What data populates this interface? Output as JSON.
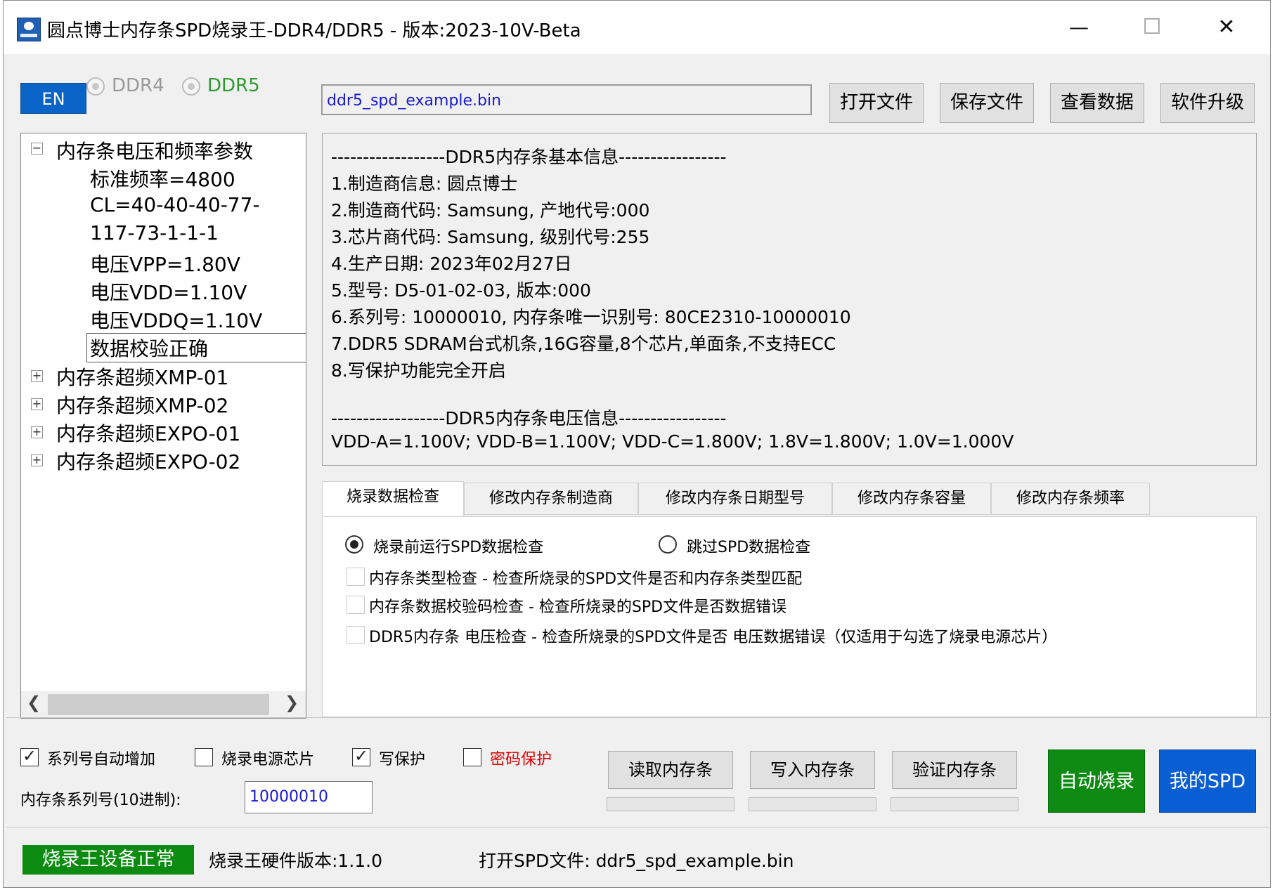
{
  "window": {
    "title": "圆点博士内存条SPD烧录王-DDR4/DDR5 - 版本:2023-10V-Beta",
    "minimize_glyph": "—",
    "maximize_glyph": "☐",
    "close_glyph": "✕"
  },
  "toolbar": {
    "lang_button": "EN",
    "ddr4_label": "DDR4",
    "ddr5_label": "DDR5",
    "file_name": "ddr5_spd_example.bin",
    "open_file": "打开文件",
    "save_file": "保存文件",
    "view_data": "查看数据",
    "upgrade": "软件升级"
  },
  "tree": {
    "root_label": "内存条电压和频率参数",
    "children": [
      "标准频率=4800",
      "CL=40-40-40-77-",
      "117-73-1-1-1",
      "电压VPP=1.80V",
      "电压VDD=1.10V",
      "电压VDDQ=1.10V",
      "数据校验正确"
    ],
    "collapsed_nodes": [
      "内存条超频XMP-01",
      "内存条超频XMP-02",
      "内存条超频EXPO-01",
      "内存条超频EXPO-02"
    ]
  },
  "info_lines": [
    "------------------DDR5内存条基本信息-----------------",
    "1.制造商信息: 圆点博士",
    "2.制造商代码: Samsung, 产地代号:000",
    "3.芯片商代码: Samsung, 级别代号:255",
    "4.生产日期: 2023年02月27日",
    "5.型号: D5-01-02-03, 版本:000",
    "6.系列号: 10000010, 内存条唯一识别号: 80CE2310-10000010",
    "7.DDR5 SDRAM台式机条,16G容量,8个芯片,单面条,不支持ECC",
    "8.写保护功能完全开启",
    "",
    "------------------DDR5内存条电压信息-----------------",
    "VDD-A=1.100V; VDD-B=1.100V; VDD-C=1.800V; 1.8V=1.800V; 1.0V=1.000V"
  ],
  "tabs": [
    "烧录数据检查",
    "修改内存条制造商",
    "修改内存条日期型号",
    "修改内存条容量",
    "修改内存条频率"
  ],
  "check_panel": {
    "radio_run": "烧录前运行SPD数据检查",
    "radio_skip": "跳过SPD数据检查",
    "opt_type": "内存条类型检查 - 检查所烧录的SPD文件是否和内存条类型匹配",
    "opt_crc": "内存条数据校验码检查 - 检查所烧录的SPD文件是否数据错误",
    "opt_voltage": "DDR5内存条 电压检查 - 检查所烧录的SPD文件是否 电压数据错误（仅适用于勾选了烧录电源芯片）"
  },
  "bottom": {
    "serial_auto": "系列号自动增加",
    "power_chip": "烧录电源芯片",
    "write_protect": "写保护",
    "password_protect": "密码保护",
    "serial_label": "内存条系列号(10进制):",
    "serial_value": "10000010",
    "read_btn": "读取内存条",
    "write_btn": "写入内存条",
    "verify_btn": "验证内存条",
    "auto_btn": "自动烧录",
    "myspd_btn": "我的SPD"
  },
  "status": {
    "device_ok": "烧录王设备正常",
    "hw_version": "烧录王硬件版本:1.1.0",
    "open_file": "打开SPD文件: ddr5_spd_example.bin"
  },
  "colors": {
    "accent_blue": "#0a63c6",
    "green_ok": "#0b8c10",
    "auto_btn_green": "#0d8a12",
    "myspd_blue": "#0a5ed4",
    "password_red": "#e00000",
    "ddr5_green": "#2e9a2e",
    "file_blue": "#1a1ad0"
  }
}
